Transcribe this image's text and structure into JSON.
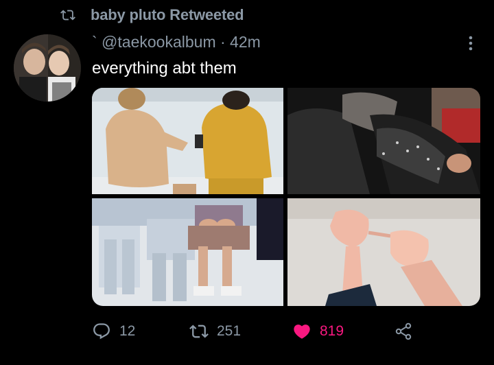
{
  "retweet": {
    "icon": "retweet-icon",
    "label": "baby pluto Retweeted"
  },
  "tweet": {
    "handle_line": "` @taekookalbum · 42m",
    "text": "everything abt them",
    "media_count": 4
  },
  "actions": {
    "reply_count": "12",
    "retweet_count": "251",
    "like_count": "819",
    "liked": true
  },
  "colors": {
    "background": "#000000",
    "secondary_text": "#8b98a5",
    "like": "#f91880"
  }
}
